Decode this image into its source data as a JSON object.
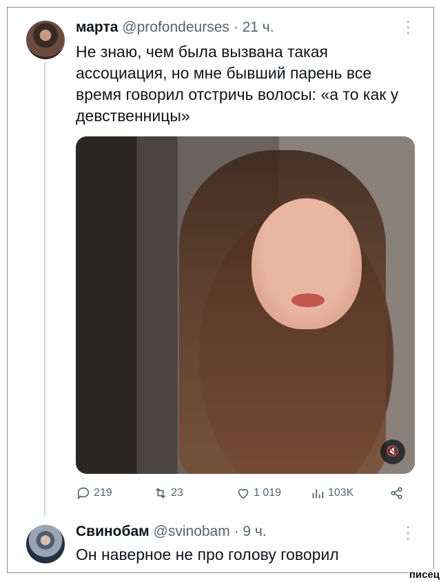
{
  "tweet1": {
    "name": "марта",
    "handle": "@profondeurses",
    "separator": "·",
    "time": "21 ч.",
    "more": "···",
    "text": "Не знаю, чем была вызвана такая ассоциация, но мне бывший парень все время говорил отстричь волосы: «а то как у девственницы»",
    "media": {
      "mute_icon": "mute-speaker-icon",
      "mute_glyph": "🔇"
    },
    "actions": {
      "replies": "219",
      "retweets": "23",
      "likes": "1 019",
      "views": "103K"
    }
  },
  "tweet2": {
    "name": "Свинобам",
    "handle": "@svinobam",
    "separator": "·",
    "time": "9 ч.",
    "more": "···",
    "text": "Он наверное не про голову говорил"
  },
  "watermark": "писец",
  "colors": {
    "text": "#0f1419",
    "secondary": "#536471",
    "thread_line": "#cfd9de"
  }
}
